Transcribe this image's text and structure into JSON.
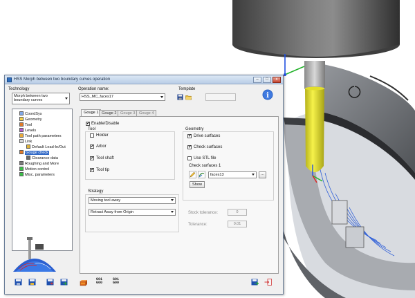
{
  "window": {
    "title": "HSS Morph between two boundary curves operation",
    "minimize": "–",
    "maximize": "□",
    "close": "x"
  },
  "technology": {
    "label": "Technology",
    "value_line1": "Morph between two",
    "value_line2": "boundary curves"
  },
  "operation_name": {
    "label": "Operation name:",
    "value": "HSS_MC_faces17"
  },
  "template": {
    "label": "Template"
  },
  "tree": {
    "items": [
      {
        "label": "CoordSys"
      },
      {
        "label": "Geometry"
      },
      {
        "label": "Tool"
      },
      {
        "label": "Levels"
      },
      {
        "label": "Tool path parameters"
      },
      {
        "label": "Link"
      },
      {
        "label": "Default Lead-In/Out"
      },
      {
        "label": "Gouge check"
      },
      {
        "label": "Clearance data"
      },
      {
        "label": "Roughing and More"
      },
      {
        "label": "Motion control"
      },
      {
        "label": "Misc. parameters"
      }
    ]
  },
  "tabs": [
    "Gouge 1",
    "Gouge 2",
    "Gouge 3",
    "Gouge 4"
  ],
  "gouge": {
    "enable_label": "Enable/Disable",
    "tool_group_label": "Tool",
    "tool_options": [
      {
        "label": "Holder",
        "checked": ""
      },
      {
        "label": "Arbor",
        "checked": "✔"
      },
      {
        "label": "Tool shaft",
        "checked": "✔"
      },
      {
        "label": "Tool tip",
        "checked": "✔"
      }
    ],
    "geometry_group_label": "Geometry",
    "geometry_options": [
      {
        "label": "Drive surfaces",
        "checked": "✔"
      },
      {
        "label": "Check surfaces",
        "checked": "✔"
      },
      {
        "label": "Use STL file",
        "checked": ""
      }
    ],
    "check_surfaces_label": "Check surfaces 1",
    "check_surfaces_value": "faces13",
    "ellipsis": "...",
    "show_button": "Show",
    "strategy_label": "Strategy",
    "strategy_value": "Moving tool away",
    "retract_value": "Retract Away from Origin",
    "stock_tolerance_label": "Stock tolerance:",
    "stock_tolerance_value": "0",
    "tolerance_label": "Tolerance:",
    "tolerance_value": "0.01"
  },
  "bottom_toolbar": {
    "g01_line1": "G01",
    "g01_line2": "G00",
    "gcode_line1": "G01",
    "gcode_line2": "G00"
  },
  "info_glyph": "i",
  "colors": {
    "accent": "#3169c6",
    "tool_yellow": "#f2ee1c",
    "tool_shaft": "#5a5a5a",
    "part_gray": "#6c6f74"
  }
}
